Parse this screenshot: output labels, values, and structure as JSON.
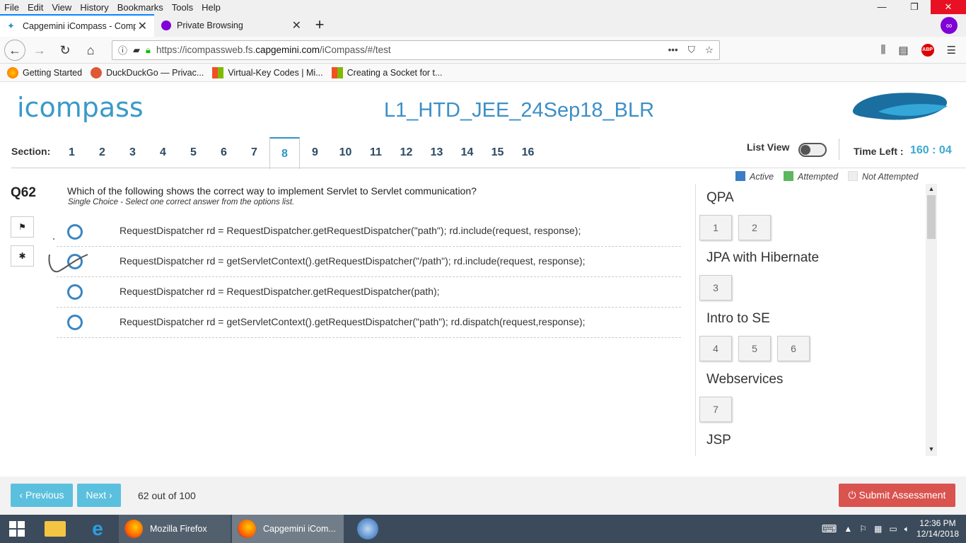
{
  "menu": [
    "File",
    "Edit",
    "View",
    "History",
    "Bookmarks",
    "Tools",
    "Help"
  ],
  "window_controls": {
    "minimize": "—",
    "maximize": "❐",
    "close": "✕"
  },
  "tabs": [
    {
      "title": "Capgemini iCompass - Compe",
      "active": true
    },
    {
      "title": "Private Browsing",
      "active": false
    }
  ],
  "url": {
    "prefix": "https://icompassweb.fs.",
    "domain": "capgemini.com",
    "path": "/iCompass/#/test"
  },
  "bookmarks": [
    "Getting Started",
    "DuckDuckGo — Privac...",
    "Virtual-Key Codes | Mi...",
    "Creating a Socket for t..."
  ],
  "app": {
    "logo": "icompass",
    "test_title": "L1_HTD_JEE_24Sep18_BLR"
  },
  "sections": {
    "label": "Section:",
    "items": [
      "1",
      "2",
      "3",
      "4",
      "5",
      "6",
      "7",
      "8",
      "9",
      "10",
      "11",
      "12",
      "13",
      "14",
      "15",
      "16"
    ],
    "active": "8"
  },
  "list_view_label": "List View",
  "time": {
    "label": "Time Left :",
    "value": "160 : 04"
  },
  "legend": [
    {
      "label": "Active",
      "color": "#3b7dc4"
    },
    {
      "label": "Attempted",
      "color": "#5cb85c"
    },
    {
      "label": "Not Attempted",
      "color": "#eeeeee"
    }
  ],
  "question": {
    "number": "Q62",
    "text": "Which of the following shows the  correct way to implement Servlet to Servlet communication?",
    "subtext": "Single Choice - Select one correct answer from the options list.",
    "options": [
      "RequestDispatcher rd = RequestDispatcher.getRequestDispatcher(\"path\"); rd.include(request, response);",
      "RequestDispatcher rd = getServletContext().getRequestDispatcher(\"/path\"); rd.include(request, response);",
      "RequestDispatcher rd = RequestDispatcher.getRequestDispatcher(path);",
      "RequestDispatcher rd = getServletContext().getRequestDispatcher(\"path\"); rd.dispatch(request,response);"
    ]
  },
  "groups": [
    {
      "title": "QPA",
      "questions": [
        "1",
        "2"
      ]
    },
    {
      "title": "JPA with Hibernate",
      "questions": [
        "3"
      ]
    },
    {
      "title": "Intro to SE",
      "questions": [
        "4",
        "5",
        "6"
      ]
    },
    {
      "title": "Webservices",
      "questions": [
        "7"
      ]
    },
    {
      "title": "JSP",
      "questions": []
    }
  ],
  "footer": {
    "previous": "‹ Previous",
    "next": "Next ›",
    "progress": "62 out of 100",
    "submit": "⏻ Submit Assessment"
  },
  "taskbar": {
    "apps": [
      {
        "label": "Mozilla Firefox",
        "active": false
      },
      {
        "label": "Capgemini iCom...",
        "active": true
      }
    ],
    "time": "12:36 PM",
    "date": "12/14/2018"
  }
}
